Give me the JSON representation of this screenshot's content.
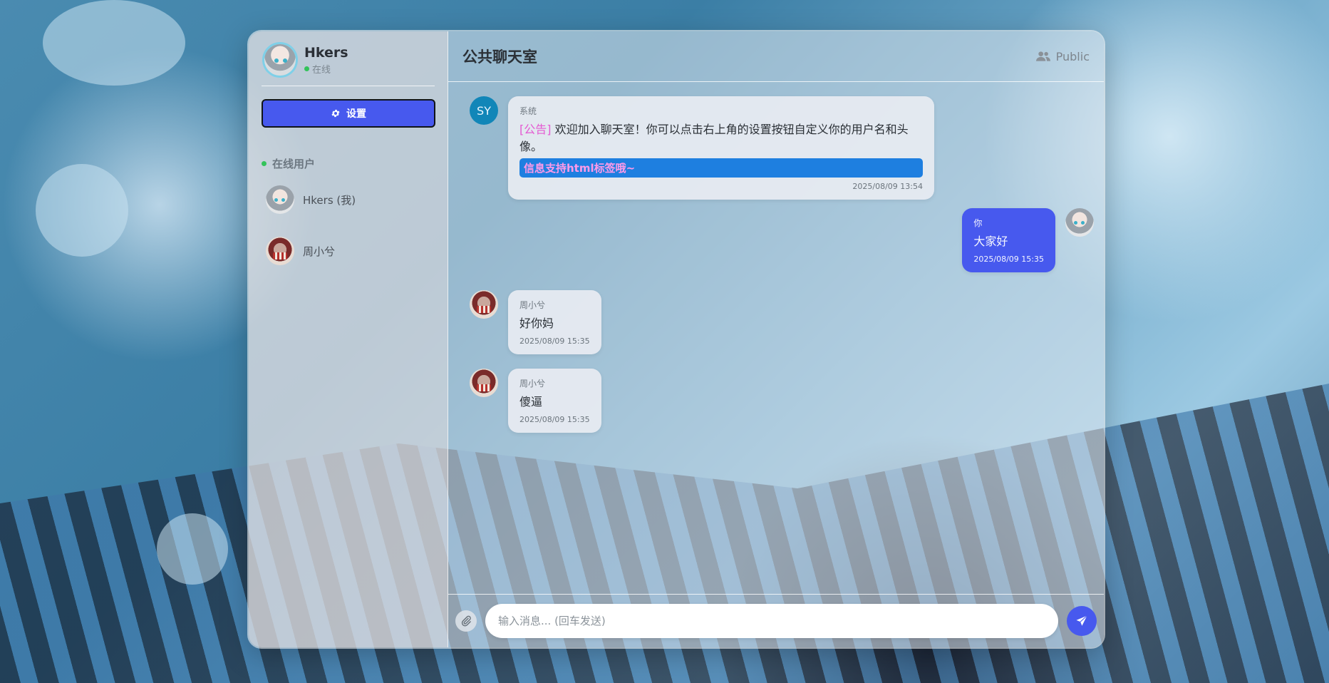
{
  "profile": {
    "name": "Hkers",
    "status": "在线"
  },
  "sidebar": {
    "settings_label": "设置",
    "online_title": "在线用户",
    "users": [
      {
        "name": "Hkers (我)"
      },
      {
        "name": "周小兮"
      }
    ]
  },
  "header": {
    "title": "公共聊天室",
    "type": "Public"
  },
  "messages": [
    {
      "sender": "系统",
      "avatar": "SY",
      "tag": "[公告]",
      "text": "欢迎加入聊天室！你可以点击右上角的设置按钮自定义你的用户名和头像。",
      "banner": "信息支持html标签哦~",
      "time": "2025/08/09 13:54"
    },
    {
      "sender": "你",
      "text": "大家好",
      "time": "2025/08/09 15:35"
    },
    {
      "sender": "周小兮",
      "text": "好你妈",
      "time": "2025/08/09 15:35"
    },
    {
      "sender": "周小兮",
      "text": "傻逼",
      "time": "2025/08/09 15:35"
    }
  ],
  "composer": {
    "placeholder": "输入消息... (回车发送)"
  },
  "colors": {
    "accent": "#4759ee",
    "online": "#33c35a",
    "system_avatar": "#1186b8",
    "tag": "#e45ad2"
  },
  "icons": [
    "gear-icon",
    "users-icon",
    "paperclip-icon",
    "send-icon"
  ]
}
